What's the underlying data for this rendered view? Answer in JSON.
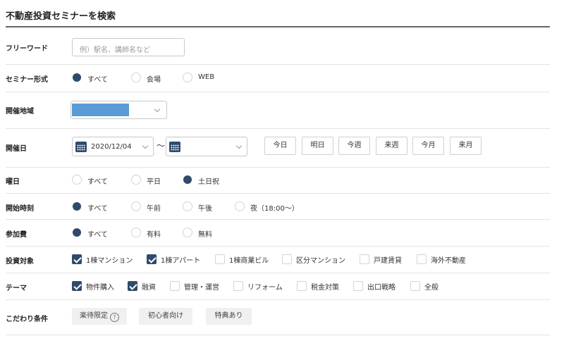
{
  "page_title": "不動産投資セミナーを検索",
  "freeword": {
    "label": "フリーワード",
    "placeholder": "例）駅名、講師名など"
  },
  "format": {
    "label": "セミナー形式",
    "options": [
      "すべて",
      "会場",
      "WEB"
    ],
    "selected": "すべて"
  },
  "region": {
    "label": "開催地域",
    "accent": "#5b9bd5"
  },
  "date": {
    "label": "開催日",
    "from": "2020/12/04",
    "tilde": "〜",
    "to": "",
    "quick": [
      "今日",
      "明日",
      "今週",
      "来週",
      "今月",
      "来月"
    ]
  },
  "weekday": {
    "label": "曜日",
    "options": [
      "すべて",
      "平日",
      "土日祝"
    ],
    "selected": "土日祝"
  },
  "start_time": {
    "label": "開始時刻",
    "options": [
      "すべて",
      "午前",
      "午後",
      "夜（18:00〜）"
    ],
    "selected": "すべて"
  },
  "fee": {
    "label": "参加費",
    "options": [
      "すべて",
      "有料",
      "無料"
    ],
    "selected": "すべて"
  },
  "target": {
    "label": "投資対象",
    "options": [
      "1棟マンション",
      "1棟アパート",
      "1棟商業ビル",
      "区分マンション",
      "戸建賃貸",
      "海外不動産"
    ],
    "checked": [
      true,
      true,
      false,
      false,
      false,
      false
    ]
  },
  "theme": {
    "label": "テーマ",
    "options": [
      "物件購入",
      "融資",
      "管理・運営",
      "リフォーム",
      "税金対策",
      "出口戦略",
      "全般"
    ],
    "checked": [
      true,
      true,
      false,
      false,
      false,
      false,
      false
    ]
  },
  "conditions": {
    "label": "こだわり条件",
    "tags": [
      "楽待限定",
      "初心者向け",
      "特典あり"
    ],
    "help": "?"
  },
  "colors": {
    "accent": "#2f4a6b",
    "region_fill": "#5b9bd5"
  }
}
